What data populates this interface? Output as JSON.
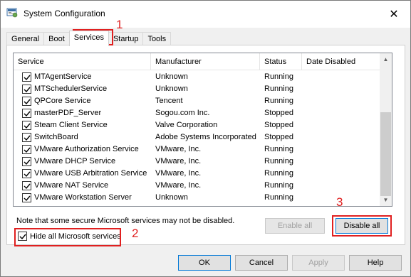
{
  "window": {
    "title": "System Configuration",
    "close_glyph": "✕"
  },
  "tabs": [
    {
      "label": "General",
      "active": false
    },
    {
      "label": "Boot",
      "active": false
    },
    {
      "label": "Services",
      "active": true
    },
    {
      "label": "Startup",
      "active": false
    },
    {
      "label": "Tools",
      "active": false
    }
  ],
  "columns": [
    "Service",
    "Manufacturer",
    "Status",
    "Date Disabled"
  ],
  "services": [
    {
      "name": "MTAgentService",
      "manufacturer": "Unknown",
      "status": "Running",
      "date_disabled": "",
      "checked": true
    },
    {
      "name": "MTSchedulerService",
      "manufacturer": "Unknown",
      "status": "Running",
      "date_disabled": "",
      "checked": true
    },
    {
      "name": "QPCore Service",
      "manufacturer": "Tencent",
      "status": "Running",
      "date_disabled": "",
      "checked": true
    },
    {
      "name": "masterPDF_Server",
      "manufacturer": "Sogou.com Inc.",
      "status": "Stopped",
      "date_disabled": "",
      "checked": true
    },
    {
      "name": "Steam Client Service",
      "manufacturer": "Valve Corporation",
      "status": "Stopped",
      "date_disabled": "",
      "checked": true
    },
    {
      "name": "SwitchBoard",
      "manufacturer": "Adobe Systems Incorporated",
      "status": "Stopped",
      "date_disabled": "",
      "checked": true
    },
    {
      "name": "VMware Authorization Service",
      "manufacturer": "VMware, Inc.",
      "status": "Running",
      "date_disabled": "",
      "checked": true
    },
    {
      "name": "VMware DHCP Service",
      "manufacturer": "VMware, Inc.",
      "status": "Running",
      "date_disabled": "",
      "checked": true
    },
    {
      "name": "VMware USB Arbitration Service",
      "manufacturer": "VMware, Inc.",
      "status": "Running",
      "date_disabled": "",
      "checked": true
    },
    {
      "name": "VMware NAT Service",
      "manufacturer": "VMware, Inc.",
      "status": "Running",
      "date_disabled": "",
      "checked": true
    },
    {
      "name": "VMware Workstation Server",
      "manufacturer": "Unknown",
      "status": "Running",
      "date_disabled": "",
      "checked": true
    }
  ],
  "note": "Note that some secure Microsoft services may not be disabled.",
  "hide_ms_label": "Hide all Microsoft services",
  "hide_ms_checked": true,
  "buttons": {
    "enable_all": "Enable all",
    "disable_all": "Disable all",
    "ok": "OK",
    "cancel": "Cancel",
    "apply": "Apply",
    "help": "Help"
  },
  "annotations": [
    "1",
    "2",
    "3"
  ],
  "colors": {
    "annotation_red": "#e02020",
    "primary_border": "#0078d7",
    "panel_bg": "#f0f0f0"
  }
}
